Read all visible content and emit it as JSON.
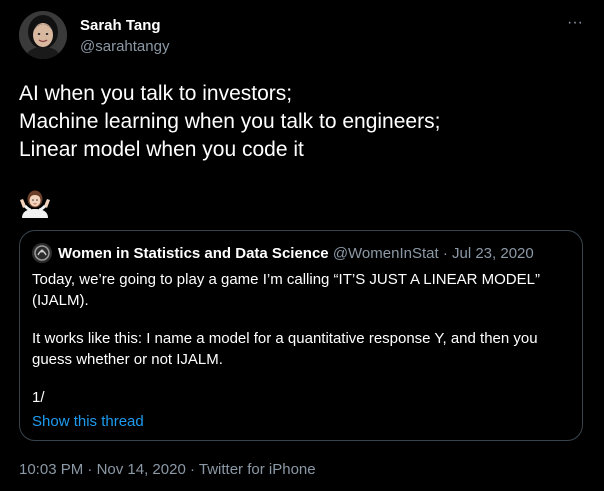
{
  "author": {
    "name": "Sarah Tang",
    "handle": "@sarahtangy"
  },
  "more_button": "···",
  "tweet": {
    "lines": [
      "AI when you talk to investors;",
      "Machine learning when you talk to engineers;",
      "Linear model when you code it"
    ],
    "emoji": "person-shrugging-emoji"
  },
  "quote": {
    "name": "Women in Statistics and Data Science",
    "handle": "@WomenInStat",
    "separator": "·",
    "date": "Jul 23, 2020",
    "paragraphs": [
      "Today, we’re going to play a game I’m calling “IT’S JUST A LINEAR MODEL” (IJALM).",
      "It works like this: I name a model for a quantitative response Y, and then you guess whether or not IJALM.",
      "1/"
    ],
    "show_thread": "Show this thread"
  },
  "footer": {
    "time": "10:03 PM",
    "date": "Nov 14, 2020",
    "source": "Twitter for iPhone",
    "separator": "·"
  },
  "colors": {
    "background": "#000000",
    "text": "#ffffff",
    "muted": "#8b98a5",
    "link": "#1d9bf0",
    "border": "#38444d"
  }
}
